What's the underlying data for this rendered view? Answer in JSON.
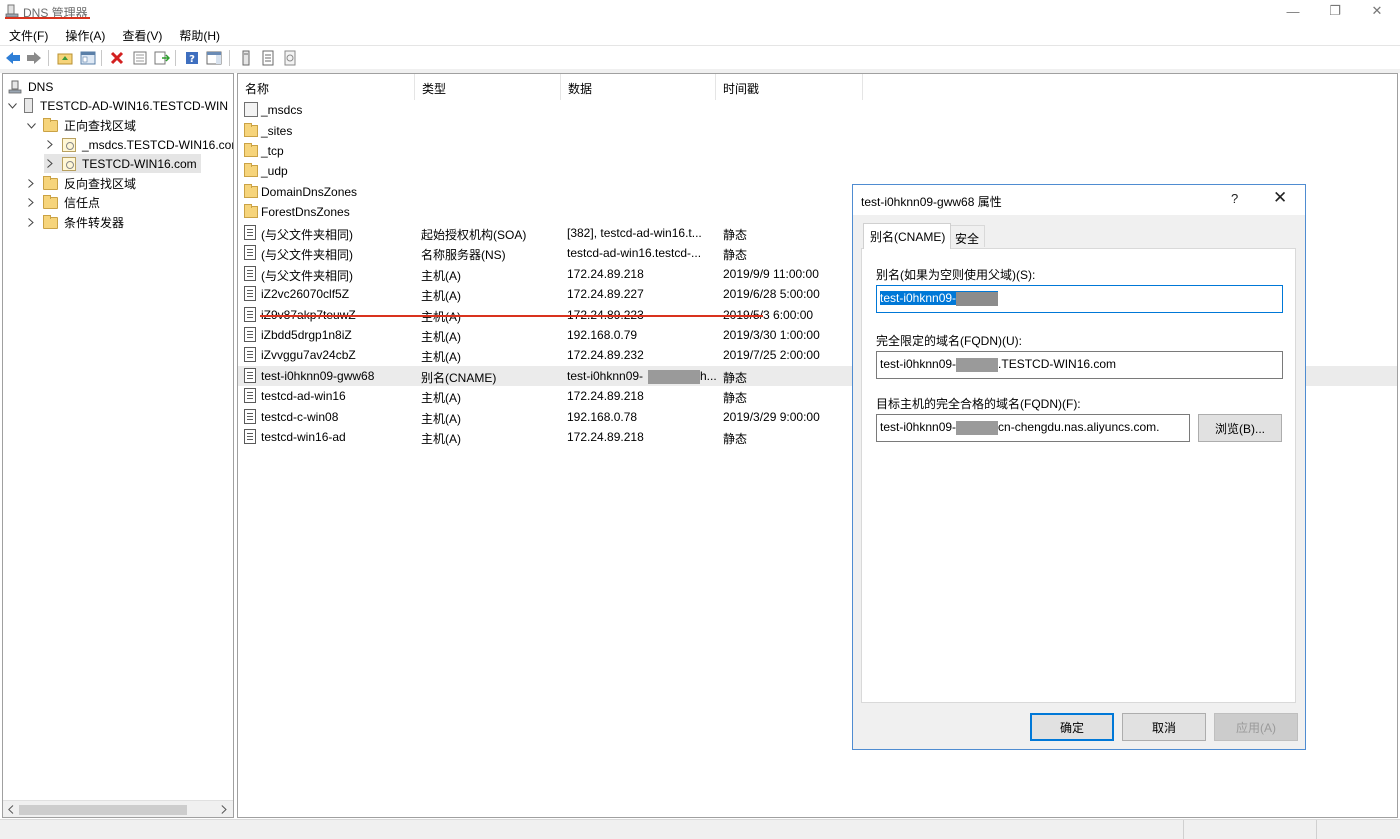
{
  "window": {
    "title": "DNS 管理器",
    "minimize_glyph": "—",
    "maximize_glyph": "❐",
    "close_glyph": "✕"
  },
  "menu": [
    "文件(F)",
    "操作(A)",
    "查看(V)",
    "帮助(H)"
  ],
  "toolbar": {
    "buttons": [
      "back-arrow-icon",
      "forward-arrow-icon",
      "up-folder-icon",
      "show-hide-tree-icon",
      "delete-icon",
      "properties-icon",
      "export-list-icon",
      "help-icon",
      "action-pane-icon",
      "server-icon",
      "record-icon",
      "zone-icon"
    ]
  },
  "tree": {
    "root": "DNS",
    "server": "TESTCD-AD-WIN16.TESTCD-WIN",
    "forward_zones": "正向查找区域",
    "zone_msdcs": "_msdcs.TESTCD-WIN16.com",
    "zone_main": "TESTCD-WIN16.com",
    "reverse_zones": "反向查找区域",
    "trust_points": "信任点",
    "conditional_forwarders": "条件转发器"
  },
  "list": {
    "columns": [
      "名称",
      "类型",
      "数据",
      "时间戳"
    ],
    "rows": [
      {
        "name": "_msdcs",
        "type": "",
        "data": "",
        "time": "",
        "icon": "msdcs"
      },
      {
        "name": "_sites",
        "type": "",
        "data": "",
        "time": "",
        "icon": "folder"
      },
      {
        "name": "_tcp",
        "type": "",
        "data": "",
        "time": "",
        "icon": "folder"
      },
      {
        "name": "_udp",
        "type": "",
        "data": "",
        "time": "",
        "icon": "folder"
      },
      {
        "name": "DomainDnsZones",
        "type": "",
        "data": "",
        "time": "",
        "icon": "folder"
      },
      {
        "name": "ForestDnsZones",
        "type": "",
        "data": "",
        "time": "",
        "icon": "folder"
      },
      {
        "name": "(与父文件夹相同)",
        "type": "起始授权机构(SOA)",
        "data": "[382], testcd-ad-win16.t...",
        "time": "静态",
        "icon": "record"
      },
      {
        "name": "(与父文件夹相同)",
        "type": "名称服务器(NS)",
        "data": "testcd-ad-win16.testcd-...",
        "time": "静态",
        "icon": "record"
      },
      {
        "name": "(与父文件夹相同)",
        "type": "主机(A)",
        "data": "172.24.89.218",
        "time": "2019/9/9 11:00:00",
        "icon": "record"
      },
      {
        "name": "iZ2vc26070clf5Z",
        "type": "主机(A)",
        "data": "172.24.89.227",
        "time": "2019/6/28 5:00:00",
        "icon": "record"
      },
      {
        "name": "iZ9v87akp7teuwZ",
        "type": "主机(A)",
        "data": "172.24.89.223",
        "time": "2019/5/3 6:00:00",
        "icon": "record"
      },
      {
        "name": "iZbdd5drgp1n8iZ",
        "type": "主机(A)",
        "data": "192.168.0.79",
        "time": "2019/3/30 1:00:00",
        "icon": "record"
      },
      {
        "name": "iZvvggu7av24cbZ",
        "type": "主机(A)",
        "data": "172.24.89.232",
        "time": "2019/7/25 2:00:00",
        "icon": "record"
      },
      {
        "name": "test-i0hknn09-gww68",
        "type": "别名(CNAME)",
        "data": "test-i0hknn09-",
        "data_suffix": "h...",
        "time": "静态",
        "icon": "record",
        "highlight": true
      },
      {
        "name": "testcd-ad-win16",
        "type": "主机(A)",
        "data": "172.24.89.218",
        "time": "静态",
        "icon": "record"
      },
      {
        "name": "testcd-c-win08",
        "type": "主机(A)",
        "data": "192.168.0.78",
        "time": "2019/3/29 9:00:00",
        "icon": "record"
      },
      {
        "name": "testcd-win16-ad",
        "type": "主机(A)",
        "data": "172.24.89.218",
        "time": "静态",
        "icon": "record"
      }
    ]
  },
  "dialog": {
    "title": "test-i0hknn09-gww68 属性",
    "help_glyph": "?",
    "close_glyph": "✕",
    "tabs": [
      "别名(CNAME)",
      "安全"
    ],
    "alias_label": "别名(如果为空则使用父域)(S):",
    "alias_value": "test-i0hknn09-",
    "fqdn_label": "完全限定的域名(FQDN)(U):",
    "fqdn_prefix": "test-i0hknn09-",
    "fqdn_suffix": ".TESTCD-WIN16.com",
    "target_label": "目标主机的完全合格的域名(FQDN)(F):",
    "target_prefix": "test-i0hknn09-",
    "target_suffix": "cn-chengdu.nas.aliyuncs.com.",
    "browse_button": "浏览(B)...",
    "ok_button": "确定",
    "cancel_button": "取消",
    "apply_button": "应用(A)"
  }
}
